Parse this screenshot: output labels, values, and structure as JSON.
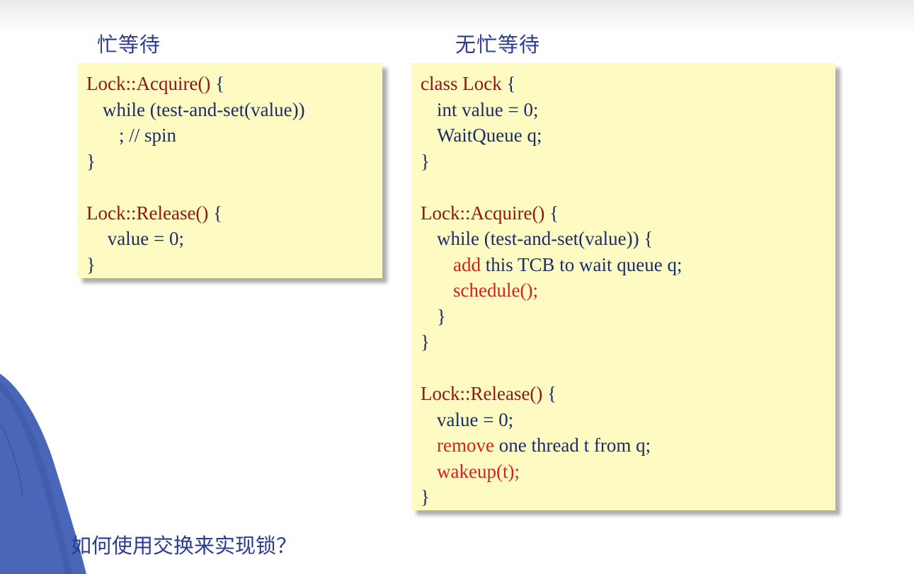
{
  "slide": {
    "heading_left": "忙等待",
    "heading_right": "无忙等待",
    "footer_question": "如何使用交换来实现锁？"
  },
  "colors": {
    "heading": "#2b3b8f",
    "code_box_bg": "#fdfbc2",
    "code_text": "#1a2d6b",
    "function_name": "#8e1616",
    "highlight_red": "#d81e1e"
  },
  "left_code": [
    {
      "indent": 0,
      "parts": [
        {
          "text": "Lock::Acquire()",
          "style": "fn"
        },
        {
          "text": " {",
          "style": "navy"
        }
      ]
    },
    {
      "indent": 1,
      "parts": [
        {
          "text": "while (test-and-set(value))",
          "style": "navy"
        }
      ]
    },
    {
      "indent": 2,
      "parts": [
        {
          "text": "; // spin",
          "style": "navy"
        }
      ]
    },
    {
      "indent": 0,
      "parts": [
        {
          "text": "}",
          "style": "navy"
        }
      ]
    },
    {
      "indent": 0,
      "parts": []
    },
    {
      "indent": 0,
      "parts": [
        {
          "text": "Lock::Release()",
          "style": "fn"
        },
        {
          "text": " {",
          "style": "navy"
        }
      ]
    },
    {
      "indent": 1,
      "parts": [
        {
          "text": " value = 0;",
          "style": "navy"
        }
      ]
    },
    {
      "indent": 0,
      "parts": [
        {
          "text": "}",
          "style": "navy"
        }
      ]
    }
  ],
  "right_code": [
    {
      "indent": 0,
      "parts": [
        {
          "text": "class Lock",
          "style": "fn"
        },
        {
          "text": " {",
          "style": "navy"
        }
      ]
    },
    {
      "indent": 1,
      "parts": [
        {
          "text": "int value = 0;",
          "style": "navy"
        }
      ]
    },
    {
      "indent": 1,
      "parts": [
        {
          "text": "WaitQueue q;",
          "style": "navy"
        }
      ]
    },
    {
      "indent": 0,
      "parts": [
        {
          "text": "}",
          "style": "navy"
        }
      ]
    },
    {
      "indent": 0,
      "parts": []
    },
    {
      "indent": 0,
      "parts": [
        {
          "text": "Lock::Acquire()",
          "style": "fn"
        },
        {
          "text": " {",
          "style": "navy"
        }
      ]
    },
    {
      "indent": 1,
      "parts": [
        {
          "text": "while (test-and-set(value)) {",
          "style": "navy"
        }
      ]
    },
    {
      "indent": 2,
      "parts": [
        {
          "text": "add",
          "style": "red"
        },
        {
          "text": " this TCB to wait queue q;",
          "style": "navy"
        }
      ]
    },
    {
      "indent": 2,
      "parts": [
        {
          "text": "schedule();",
          "style": "red"
        }
      ]
    },
    {
      "indent": 1,
      "parts": [
        {
          "text": "}",
          "style": "navy"
        }
      ]
    },
    {
      "indent": 0,
      "parts": [
        {
          "text": "}",
          "style": "navy"
        }
      ]
    },
    {
      "indent": 0,
      "parts": []
    },
    {
      "indent": 0,
      "parts": [
        {
          "text": "Lock::Release()",
          "style": "fn"
        },
        {
          "text": " {",
          "style": "navy"
        }
      ]
    },
    {
      "indent": 1,
      "parts": [
        {
          "text": "value = 0;",
          "style": "navy"
        }
      ]
    },
    {
      "indent": 1,
      "parts": [
        {
          "text": "remove",
          "style": "red"
        },
        {
          "text": " one thread t from q;",
          "style": "navy"
        }
      ]
    },
    {
      "indent": 1,
      "parts": [
        {
          "text": "wakeup(t);",
          "style": "red"
        }
      ]
    },
    {
      "indent": 0,
      "parts": [
        {
          "text": "}",
          "style": "navy"
        }
      ]
    }
  ]
}
